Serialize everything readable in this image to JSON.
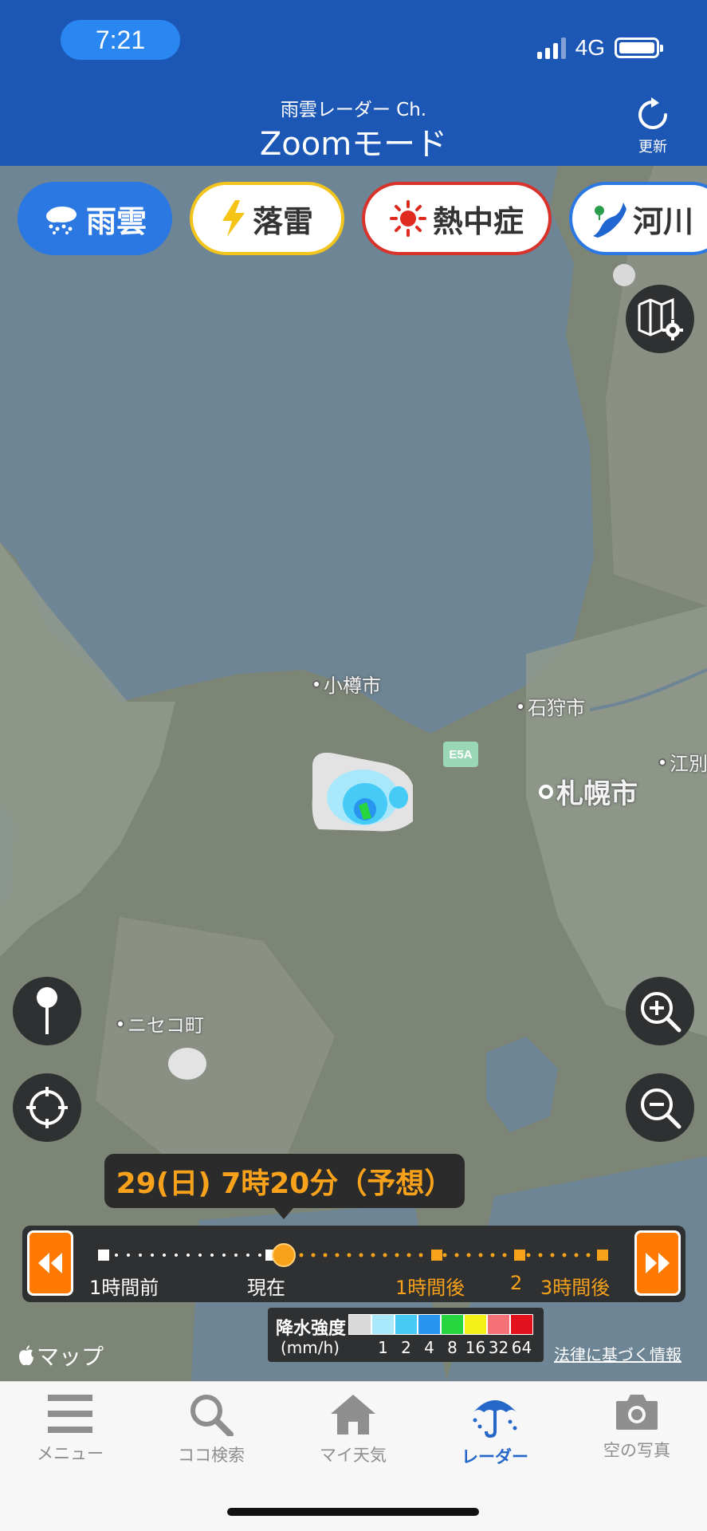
{
  "status_bar": {
    "time": "7:21",
    "network": "4G",
    "battery_fraction": 1.0
  },
  "header": {
    "subtitle": "雨雲レーダー Ch.",
    "title": "Zoomモード",
    "refresh_label": "更新"
  },
  "categories": [
    {
      "label": "雨雲",
      "icon": "rain-cloud-icon",
      "active": true
    },
    {
      "label": "落雷",
      "icon": "lightning-icon",
      "active": false
    },
    {
      "label": "熱中症",
      "icon": "sun-icon",
      "active": false
    },
    {
      "label": "河川",
      "icon": "river-icon",
      "active": false
    }
  ],
  "map": {
    "cities": [
      "小樽市",
      "石狩市",
      "札幌市",
      "江別",
      "ニセコ町"
    ],
    "highway": "E5A",
    "attribution": "マップ",
    "legal_link": "法律に基づく情報"
  },
  "timeline": {
    "current_time": "29(日) 7時20分（予想）",
    "labels": {
      "past": "1時間前",
      "now": "現在",
      "plus1": "1時間後",
      "plus2": "2",
      "plus3": "3時間後"
    }
  },
  "legend": {
    "title": "降水強度",
    "unit": "(mm/h)",
    "values": [
      "1",
      "2",
      "4",
      "8",
      "16",
      "32",
      "64"
    ],
    "colors": [
      "#d9d9d9",
      "#a9e8fb",
      "#46cbf6",
      "#2a95ef",
      "#27d63f",
      "#f4f118",
      "#f47178",
      "#e3101d"
    ]
  },
  "tabs": [
    {
      "label": "メニュー",
      "icon": "menu-icon",
      "active": false
    },
    {
      "label": "ココ検索",
      "icon": "search-icon",
      "active": false
    },
    {
      "label": "マイ天気",
      "icon": "home-icon",
      "active": false
    },
    {
      "label": "レーダー",
      "icon": "umbrella-icon",
      "active": true
    },
    {
      "label": "空の写真",
      "icon": "camera-icon",
      "active": false
    }
  ],
  "colors": {
    "header": "#1c57b6",
    "accent": "#2b78e3",
    "orange": "#f7a21a"
  }
}
